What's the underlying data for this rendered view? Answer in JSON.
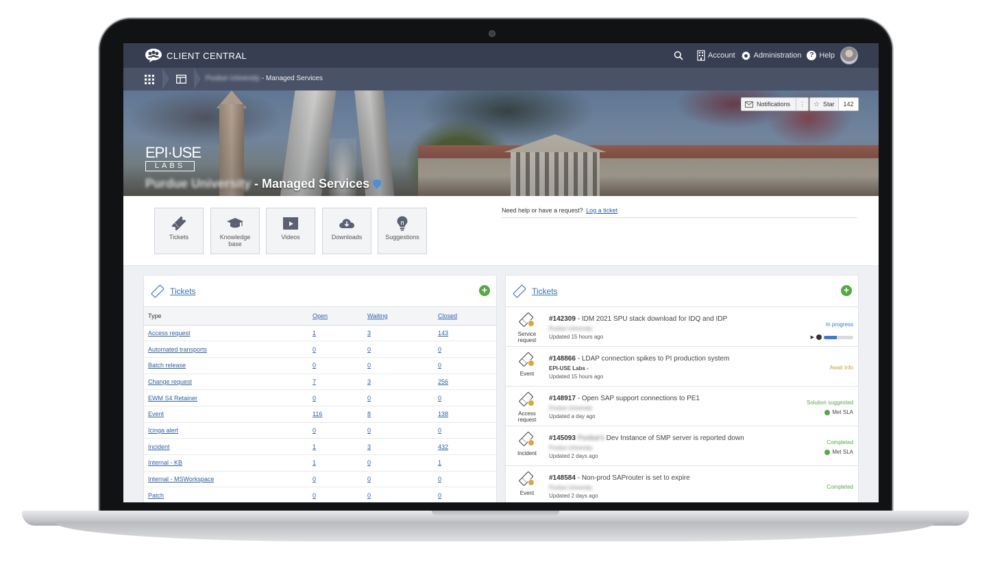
{
  "app": {
    "title": "CLIENT CENTRAL",
    "nav": {
      "account": "Account",
      "administration": "Administration",
      "help": "Help"
    }
  },
  "breadcrumb": {
    "client": "Purdue University",
    "page": "- Managed Services"
  },
  "hero": {
    "notifications_label": "Notifications",
    "star_label": "Star",
    "star_count": "142",
    "logo_top": "EPI·USE",
    "logo_bottom": "LABS",
    "title_blurred": "Purdue University",
    "title": "- Managed Services"
  },
  "tiles": [
    {
      "label": "Tickets",
      "icon": "ticket-icon"
    },
    {
      "label": "Knowledge base",
      "icon": "graduation-cap-icon"
    },
    {
      "label": "Videos",
      "icon": "video-icon"
    },
    {
      "label": "Downloads",
      "icon": "cloud-download-icon"
    },
    {
      "label": "Suggestions",
      "icon": "lightbulb-icon"
    }
  ],
  "help": {
    "text": "Need help or have a request?",
    "link": "Log a ticket"
  },
  "left_panel": {
    "title": "Tickets",
    "columns": [
      "Type",
      "Open",
      "Waiting",
      "Closed"
    ],
    "rows": [
      [
        "Access request",
        "1",
        "3",
        "143"
      ],
      [
        "Automated transports",
        "0",
        "0",
        "0"
      ],
      [
        "Batch release",
        "0",
        "0",
        "0"
      ],
      [
        "Change request",
        "7",
        "3",
        "256"
      ],
      [
        "EWM S4 Retainer",
        "0",
        "0",
        "0"
      ],
      [
        "Event",
        "116",
        "8",
        "138"
      ],
      [
        "Icinga alert",
        "0",
        "0",
        "0"
      ],
      [
        "Incident",
        "1",
        "3",
        "432"
      ],
      [
        "Internal - KB",
        "1",
        "0",
        "1"
      ],
      [
        "Internal - MSWorkspace",
        "0",
        "0",
        "0"
      ],
      [
        "Patch",
        "0",
        "0",
        "0"
      ]
    ]
  },
  "right_panel": {
    "title": "Tickets",
    "tickets": [
      {
        "type": "Service request",
        "number": "#142309",
        "title": "- IDM 2021 SPU stack download for IDQ and IDP",
        "sub": "Purdue University",
        "updated": "Updated 15 hours ago",
        "status": "In progress",
        "status_color": "#3a7bd5",
        "progress": 0.45,
        "sla": ""
      },
      {
        "type": "Event",
        "number": "#148866",
        "title": "- LDAP connection spikes to PI production system",
        "sub": "EPI-USE Labs -",
        "updated": "Updated 15 hours ago",
        "status": "Await info",
        "status_color": "#c9a227",
        "sla": ""
      },
      {
        "type": "Access request",
        "number": "#148917",
        "title": "- Open SAP support connections to PE1",
        "sub": "Purdue University",
        "updated": "Updated a day ago",
        "status": "Solution suggested",
        "status_color": "#5aa84a",
        "sla": "Met SLA"
      },
      {
        "type": "Incident",
        "number": "#145093",
        "title_blur": "Purdue's",
        "title": "Dev Instance of SMP server is reported down",
        "sub": "Purdue University",
        "updated": "Updated 2 days ago",
        "status": "Completed",
        "status_color": "#5aa84a",
        "sla": "Met SLA"
      },
      {
        "type": "Event",
        "number": "#148584",
        "title": "- Non-prod SAProuter is set to expire",
        "sub": "Purdue University",
        "updated": "Updated 2 days ago",
        "status": "Completed",
        "status_color": "#5aa84a",
        "sla": ""
      }
    ]
  }
}
